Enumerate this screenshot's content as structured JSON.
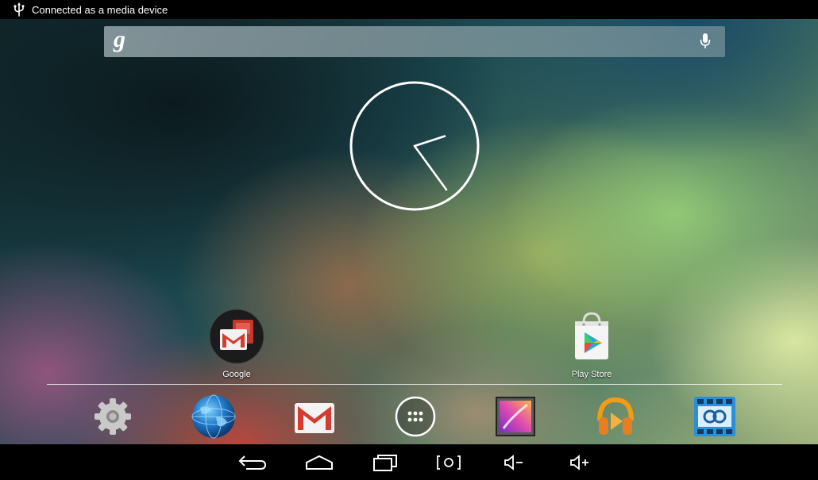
{
  "status_bar": {
    "notification_icon": "usb-icon",
    "notification_text": "Connected as a media device"
  },
  "search_bar": {
    "logo_text": "g",
    "value": "",
    "placeholder": "",
    "mic_icon": "mic-icon"
  },
  "clock": {
    "type": "analog",
    "hour_hand_deg": 144,
    "minute_hand_deg": 72
  },
  "desktop": {
    "apps": [
      {
        "label": "Google",
        "icon": "google-folder-icon"
      },
      {
        "label": "Play Store",
        "icon": "play-store-icon"
      }
    ]
  },
  "dock": {
    "items": [
      {
        "icon": "settings-icon"
      },
      {
        "icon": "browser-icon"
      },
      {
        "icon": "gmail-icon"
      },
      {
        "icon": "app-drawer-icon"
      },
      {
        "icon": "gallery-icon"
      },
      {
        "icon": "play-music-icon"
      },
      {
        "icon": "movie-studio-icon"
      }
    ]
  },
  "nav_bar": {
    "buttons": [
      {
        "icon": "back-icon"
      },
      {
        "icon": "home-icon"
      },
      {
        "icon": "recents-icon"
      },
      {
        "icon": "screenshot-icon"
      },
      {
        "icon": "volume-down-icon"
      },
      {
        "icon": "volume-up-icon"
      }
    ]
  },
  "colors": {
    "status_bar": "#000000",
    "nav_bar": "#000000",
    "text": "#ffffff"
  }
}
